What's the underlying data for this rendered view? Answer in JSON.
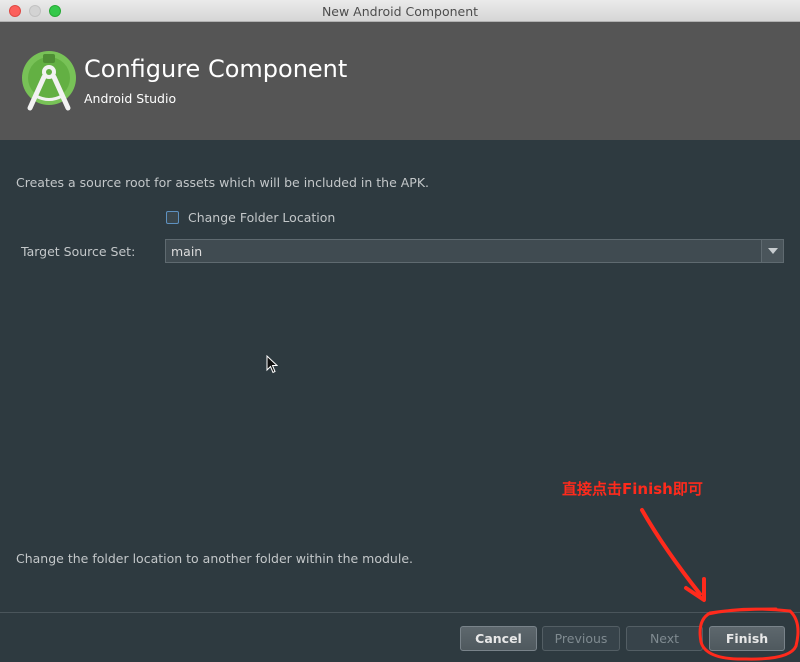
{
  "window": {
    "title": "New Android Component"
  },
  "header": {
    "title": "Configure Component",
    "subtitle": "Android Studio"
  },
  "form": {
    "description": "Creates a source root for assets which will be included in the APK.",
    "change_folder_label": "Change Folder Location",
    "change_folder_checked": false,
    "target_source_set_label": "Target Source Set:",
    "target_source_set_value": "main"
  },
  "hint": "Change the folder location to another folder within the module.",
  "buttons": {
    "cancel": "Cancel",
    "previous": "Previous",
    "next": "Next",
    "finish": "Finish"
  },
  "annotation": {
    "text": "直接点击Finish即可",
    "color": "#ff2a1c"
  },
  "colors": {
    "background": "#2e3a40",
    "header": "#555555",
    "logo": "#78c257",
    "checkbox_border": "#5e91c0"
  }
}
